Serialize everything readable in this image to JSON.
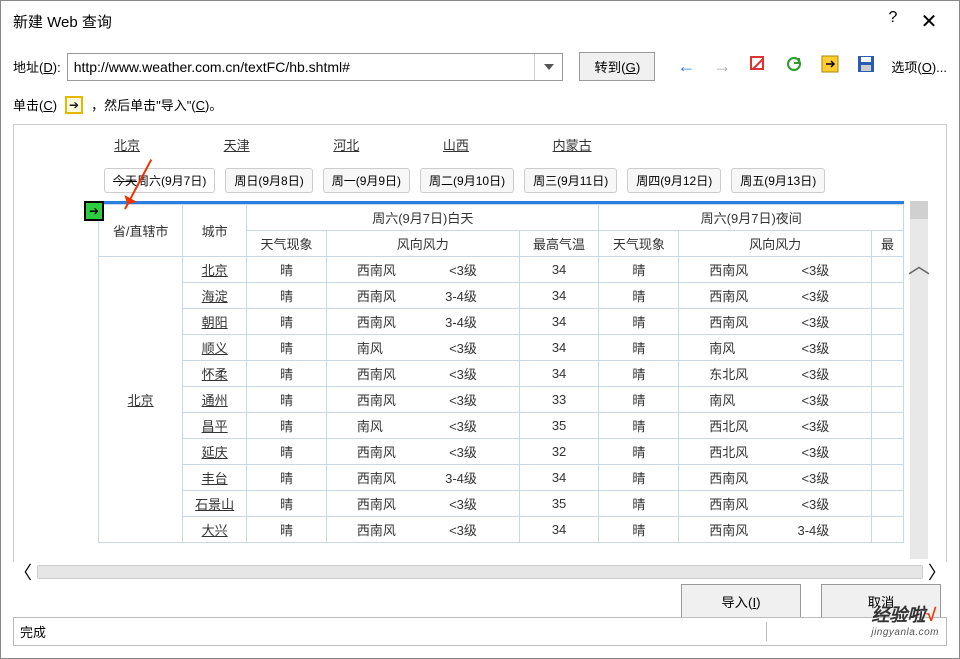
{
  "title": "新建 Web 查询",
  "titlebar": {
    "help": "?",
    "close": "✕"
  },
  "address": {
    "label_pre": "地址(",
    "label_key": "D",
    "label_post": "):",
    "url": "http://www.weather.com.cn/textFC/hb.shtml#",
    "go_pre": "转到(",
    "go_key": "G",
    "go_post": ")",
    "options_pre": "选项(",
    "options_key": "O",
    "options_post": ")..."
  },
  "instr": {
    "pre1": "单击(",
    "key1": "C",
    "post1": ")",
    "pre2": "，然后单击\"导入\"(",
    "key2": "C",
    "post2": ")。"
  },
  "provinces": [
    "北京",
    "天津",
    "河北",
    "山西",
    "内蒙古"
  ],
  "dates": [
    {
      "strike": "今天",
      "rest": "周六(9月7日)"
    },
    "周日(9月8日)",
    "周一(9月9日)",
    "周二(9月10日)",
    "周三(9月11日)",
    "周四(9月12日)",
    "周五(9月13日)"
  ],
  "table": {
    "hdr": {
      "prov": "省/直辖市",
      "city": "城市",
      "day": "周六(9月7日)白天",
      "night": "周六(9月7日)夜间",
      "weather": "天气现象",
      "wind": "风向风力",
      "high": "最高气温",
      "low": "最"
    },
    "prov_label": "北京",
    "rows": [
      {
        "city": "北京",
        "dw": "晴",
        "ddir": "西南风",
        "dlv": "<3级",
        "hi": "34",
        "nw": "晴",
        "ndir": "西南风",
        "nlv": "<3级"
      },
      {
        "city": "海淀",
        "dw": "晴",
        "ddir": "西南风",
        "dlv": "3-4级",
        "hi": "34",
        "nw": "晴",
        "ndir": "西南风",
        "nlv": "<3级"
      },
      {
        "city": "朝阳",
        "dw": "晴",
        "ddir": "西南风",
        "dlv": "3-4级",
        "hi": "34",
        "nw": "晴",
        "ndir": "西南风",
        "nlv": "<3级"
      },
      {
        "city": "顺义",
        "dw": "晴",
        "ddir": "南风",
        "dlv": "<3级",
        "hi": "34",
        "nw": "晴",
        "ndir": "南风",
        "nlv": "<3级"
      },
      {
        "city": "怀柔",
        "dw": "晴",
        "ddir": "西南风",
        "dlv": "<3级",
        "hi": "34",
        "nw": "晴",
        "ndir": "东北风",
        "nlv": "<3级"
      },
      {
        "city": "通州",
        "dw": "晴",
        "ddir": "西南风",
        "dlv": "<3级",
        "hi": "33",
        "nw": "晴",
        "ndir": "南风",
        "nlv": "<3级"
      },
      {
        "city": "昌平",
        "dw": "晴",
        "ddir": "南风",
        "dlv": "<3级",
        "hi": "35",
        "nw": "晴",
        "ndir": "西北风",
        "nlv": "<3级"
      },
      {
        "city": "延庆",
        "dw": "晴",
        "ddir": "西南风",
        "dlv": "<3级",
        "hi": "32",
        "nw": "晴",
        "ndir": "西北风",
        "nlv": "<3级"
      },
      {
        "city": "丰台",
        "dw": "晴",
        "ddir": "西南风",
        "dlv": "3-4级",
        "hi": "34",
        "nw": "晴",
        "ndir": "西南风",
        "nlv": "<3级"
      },
      {
        "city": "石景山",
        "dw": "晴",
        "ddir": "西南风",
        "dlv": "<3级",
        "hi": "35",
        "nw": "晴",
        "ndir": "西南风",
        "nlv": "<3级"
      },
      {
        "city": "大兴",
        "dw": "晴",
        "ddir": "西南风",
        "dlv": "<3级",
        "hi": "34",
        "nw": "晴",
        "ndir": "西南风",
        "nlv": "3-4级"
      }
    ]
  },
  "buttons": {
    "import_pre": "导入(",
    "import_key": "I",
    "import_post": ")",
    "cancel": "取消"
  },
  "status": "完成",
  "watermark": {
    "t1a": "经验啦",
    "t1b": "√",
    "t2": "jingyanla.com"
  }
}
